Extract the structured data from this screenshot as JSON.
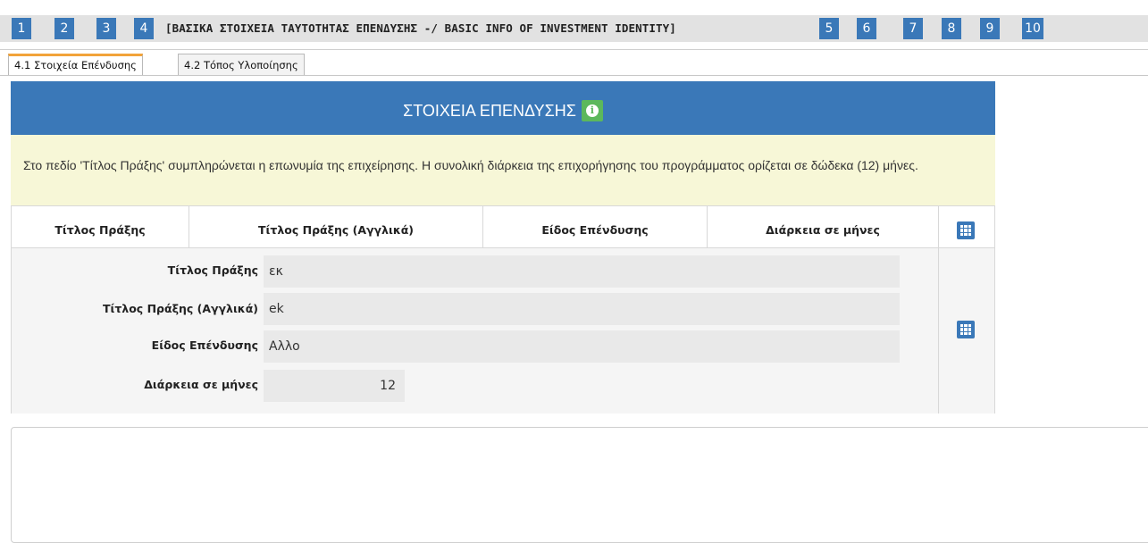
{
  "stepbar": {
    "steps": [
      "1",
      "2",
      "3",
      "4",
      "5",
      "6",
      "7",
      "8",
      "9",
      "10"
    ],
    "current_title": "[ΒΑΣΙΚΑ ΣΤΟΙΧΕΙΑ ΤΑΥΤΟΤΗΤΑΣ ΕΠΕΝΔΥΣΗΣ -/ BASIC INFO OF INVESTMENT IDENTITY]"
  },
  "tabs": [
    {
      "label": "4.1 Στοιχεία Επένδυσης",
      "active": true
    },
    {
      "label": "4.2 Τόπος Υλοποίησης",
      "active": false
    }
  ],
  "panel": {
    "title": "ΣΤΟΙΧΕΙΑ ΕΠΕΝΔΥΣΗΣ",
    "info_icon": "info-circle-icon",
    "notice": "Στο πεδίο 'Τίτλος Πράξης' συμπληρώνεται η επωνυμία της επιχείρησης. Η συνολική διάρκεια της επιχορήγησης του προγράμματος ορίζεται σε δώδεκα (12) μήνες."
  },
  "table": {
    "columns": [
      "Τίτλος Πράξης",
      "Τίτλος Πράξης (Αγγλικά)",
      "Είδος Επένδυσης",
      "Διάρκεια σε μήνες"
    ],
    "grid_icon": "grid-icon",
    "row": {
      "fields": [
        {
          "label": "Τίτλος Πράξης",
          "value": "εκ"
        },
        {
          "label": "Τίτλος Πράξης (Αγγλικά)",
          "value": "ek"
        },
        {
          "label": "Είδος Επένδυσης",
          "value": "Αλλο"
        },
        {
          "label": "Διάρκεια σε μήνες",
          "value": "12"
        }
      ]
    }
  },
  "colors": {
    "accent": "#3a78b8",
    "info_green": "#5cb85c",
    "notice_bg": "#f7f7d7",
    "active_tab_border": "#f2a33a"
  }
}
